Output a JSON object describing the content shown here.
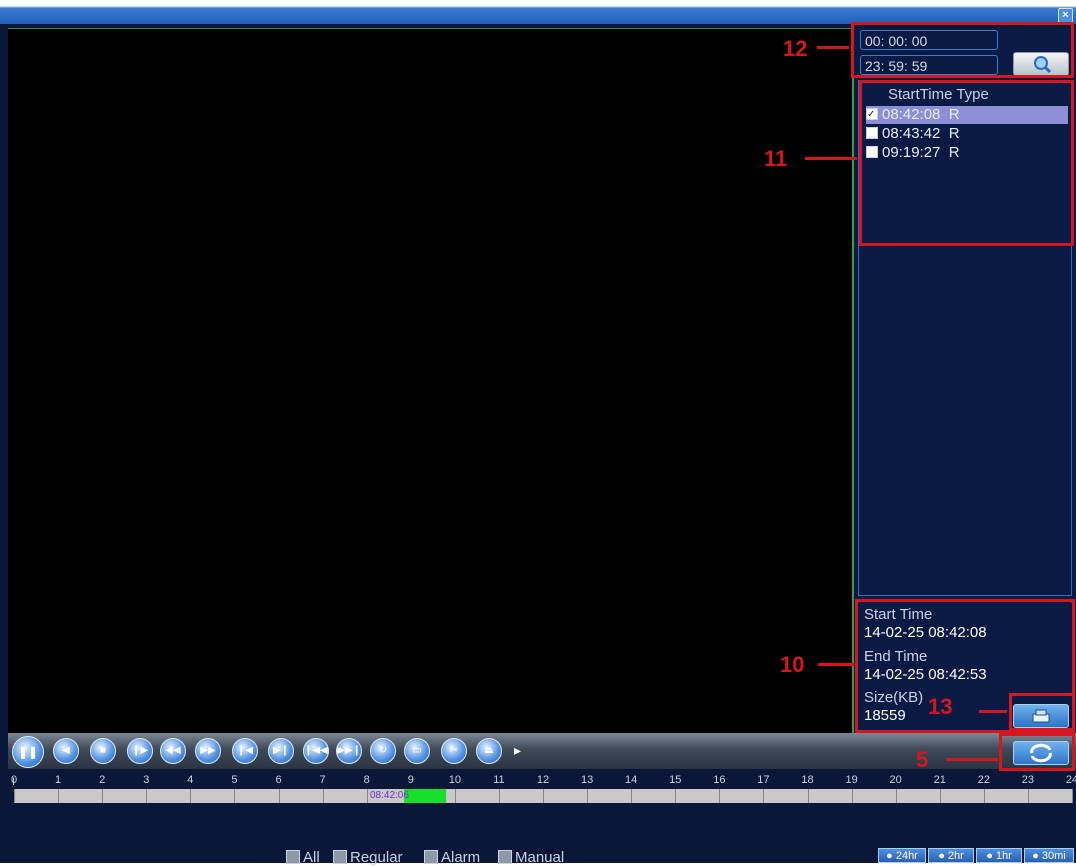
{
  "window": {
    "close_glyph": "×"
  },
  "search": {
    "start_time": "00: 00: 00",
    "end_time": "23: 59: 59",
    "search_icon": "magnifier-icon"
  },
  "file_list": {
    "header": "StartTime Type",
    "rows": [
      {
        "time": "08:42:08",
        "type": "R",
        "checked": true,
        "selected": true
      },
      {
        "time": "08:43:42",
        "type": "R",
        "checked": false,
        "selected": false
      },
      {
        "time": "09:19:27",
        "type": "R",
        "checked": false,
        "selected": false
      }
    ]
  },
  "file_info": {
    "start_label": "Start Time",
    "start_value": "14-02-25 08:42:08",
    "end_label": "End Time",
    "end_value": "14-02-25 08:42:53",
    "size_label": "Size(KB)",
    "size_value": "18559",
    "backup_icon": "backup-icon"
  },
  "controls": [
    {
      "name": "pause-button",
      "icon": "pause-icon",
      "glyph": "❚❚"
    },
    {
      "name": "play-backward-button",
      "icon": "play-backward-icon",
      "glyph": "◀"
    },
    {
      "name": "stop-button",
      "icon": "stop-icon",
      "glyph": "■"
    },
    {
      "name": "slow-play-button",
      "icon": "slow-play-icon",
      "glyph": "❙▶"
    },
    {
      "name": "fast-backward-button",
      "icon": "fast-backward-icon",
      "glyph": "◀◀"
    },
    {
      "name": "fast-forward-button",
      "icon": "fast-forward-icon",
      "glyph": "▶▶"
    },
    {
      "name": "previous-frame-button",
      "icon": "previous-frame-icon",
      "glyph": "❙◀"
    },
    {
      "name": "next-frame-button",
      "icon": "next-frame-icon",
      "glyph": "▶❙"
    },
    {
      "name": "previous-file-button",
      "icon": "previous-file-icon",
      "glyph": "❙◀◀"
    },
    {
      "name": "next-file-button",
      "icon": "next-file-icon",
      "glyph": "▶▶❙"
    },
    {
      "name": "loop-button",
      "icon": "loop-icon",
      "glyph": "↻"
    },
    {
      "name": "fullscreen-button",
      "icon": "fullscreen-icon",
      "glyph": "▭"
    },
    {
      "name": "clip-button",
      "icon": "scissors-icon",
      "glyph": "✂"
    },
    {
      "name": "backup-clip-button",
      "icon": "backup-icon",
      "glyph": "⏏"
    }
  ],
  "expand_glyph": "▸",
  "sync_icon": "sync-icon",
  "timeline": {
    "hours": [
      "0",
      "1",
      "2",
      "3",
      "4",
      "5",
      "6",
      "7",
      "8",
      "9",
      "10",
      "11",
      "12",
      "13",
      "14",
      "15",
      "16",
      "17",
      "18",
      "19",
      "20",
      "21",
      "22",
      "23",
      "24"
    ],
    "marker": "I",
    "segment_label": "08:42:06",
    "segment_color": "#18e02a"
  },
  "filters": [
    {
      "label": "All",
      "checked": true
    },
    {
      "label": "Regular",
      "checked": true
    },
    {
      "label": "Alarm",
      "checked": true
    },
    {
      "label": "Manual",
      "checked": true
    }
  ],
  "zoom": [
    "24hr",
    "2hr",
    "1hr",
    "30mi"
  ],
  "annotations": {
    "n12": "12",
    "n11": "11",
    "n10": "10",
    "n13": "13",
    "n5": "5"
  },
  "colors": {
    "annotation": "#d6161f",
    "selection": "#8d8fd6",
    "panel_bg": "#0b1a44"
  }
}
